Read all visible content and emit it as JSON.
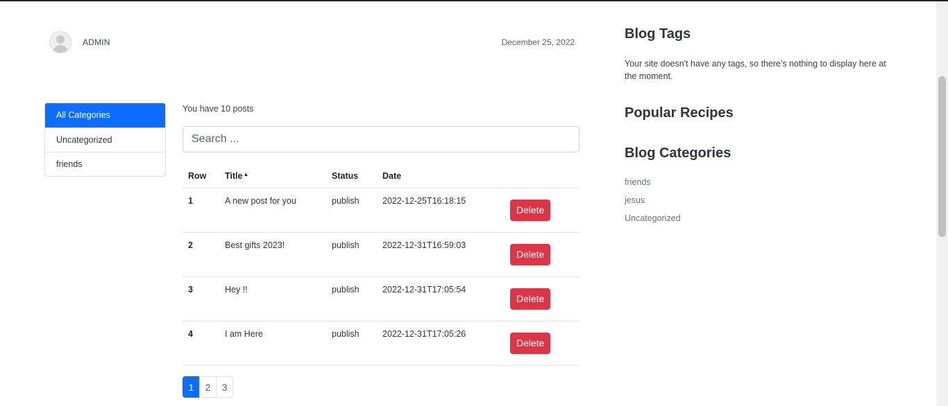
{
  "author": {
    "name": "ADMIN",
    "date": "December 25, 2022"
  },
  "categories": {
    "items": [
      {
        "label": "All Categories"
      },
      {
        "label": "Uncategorized"
      },
      {
        "label": "friends"
      }
    ],
    "active": "All Categories"
  },
  "posts": {
    "count_text": "You have 10 posts",
    "search_placeholder": "Search ...",
    "columns": {
      "row": "Row",
      "title": "Title",
      "status": "Status",
      "date": "Date"
    },
    "sort_indicator": "▲",
    "rows": [
      {
        "row": "1",
        "title": "A new post for you",
        "status": "publish",
        "date": "2022-12-25T16:18:15",
        "action": "Delete"
      },
      {
        "row": "2",
        "title": "Best gifts 2023!",
        "status": "publish",
        "date": "2022-12-31T16:59:03",
        "action": "Delete"
      },
      {
        "row": "3",
        "title": "Hey !!",
        "status": "publish",
        "date": "2022-12-31T17:05:54",
        "action": "Delete"
      },
      {
        "row": "4",
        "title": "I am Here",
        "status": "publish",
        "date": "2022-12-31T17:05:26",
        "action": "Delete"
      }
    ]
  },
  "pagination": {
    "pages": [
      "1",
      "2",
      "3"
    ],
    "current": "1"
  },
  "sidebar": {
    "tags_heading": "Blog Tags",
    "tags_text": "Your site doesn't have any tags, so there's nothing to display here at the moment.",
    "recipes_heading": "Popular Recipes",
    "categories_heading": "Blog Categories",
    "category_links": [
      "friends",
      "jesus",
      "Uncategorized"
    ]
  },
  "colors": {
    "primary": "#0d6efd",
    "danger": "#dc3545"
  }
}
